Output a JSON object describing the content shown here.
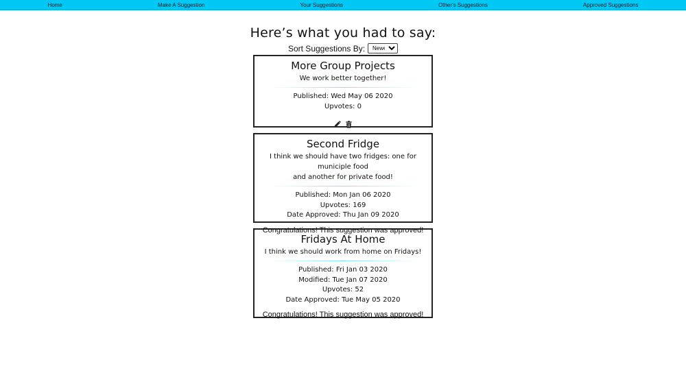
{
  "nav": {
    "items": [
      "Home",
      "Make A Suggestion",
      "Your Suggestions",
      "Other's Suggestions",
      "Approved Suggestions"
    ]
  },
  "heading": "Here’s what you had to say:",
  "sort": {
    "label": "Sort Suggestions By:",
    "selected": "Newest"
  },
  "cards": [
    {
      "title": "More Group Projects",
      "body": "We work better together!",
      "published": "Published: Wed May 06 2020",
      "upvotes": "Upvotes: 0",
      "icons": [
        "pencil-icon",
        "trash-icon"
      ]
    },
    {
      "title": "Second Fridge",
      "body_line1": "I think we should have two fridges: one for municiple food",
      "body_line2": "and another for private food!",
      "published": "Published: Mon Jan 06 2020",
      "upvotes": "Upvotes: 169",
      "approved": "Date Approved: Thu Jan 09 2020",
      "congrats": "Congratulations! This suggestion was approved!"
    },
    {
      "title": "Fridays At Home",
      "body": "I think we should work from home on Fridays!",
      "published": "Published: Fri Jan 03 2020",
      "modified": "Modified: Tue Jan 07 2020",
      "upvotes": "Upvotes: 52",
      "approved": "Date Approved: Tue May 05 2020",
      "congrats": "Congratulations! This suggestion was approved!"
    }
  ]
}
